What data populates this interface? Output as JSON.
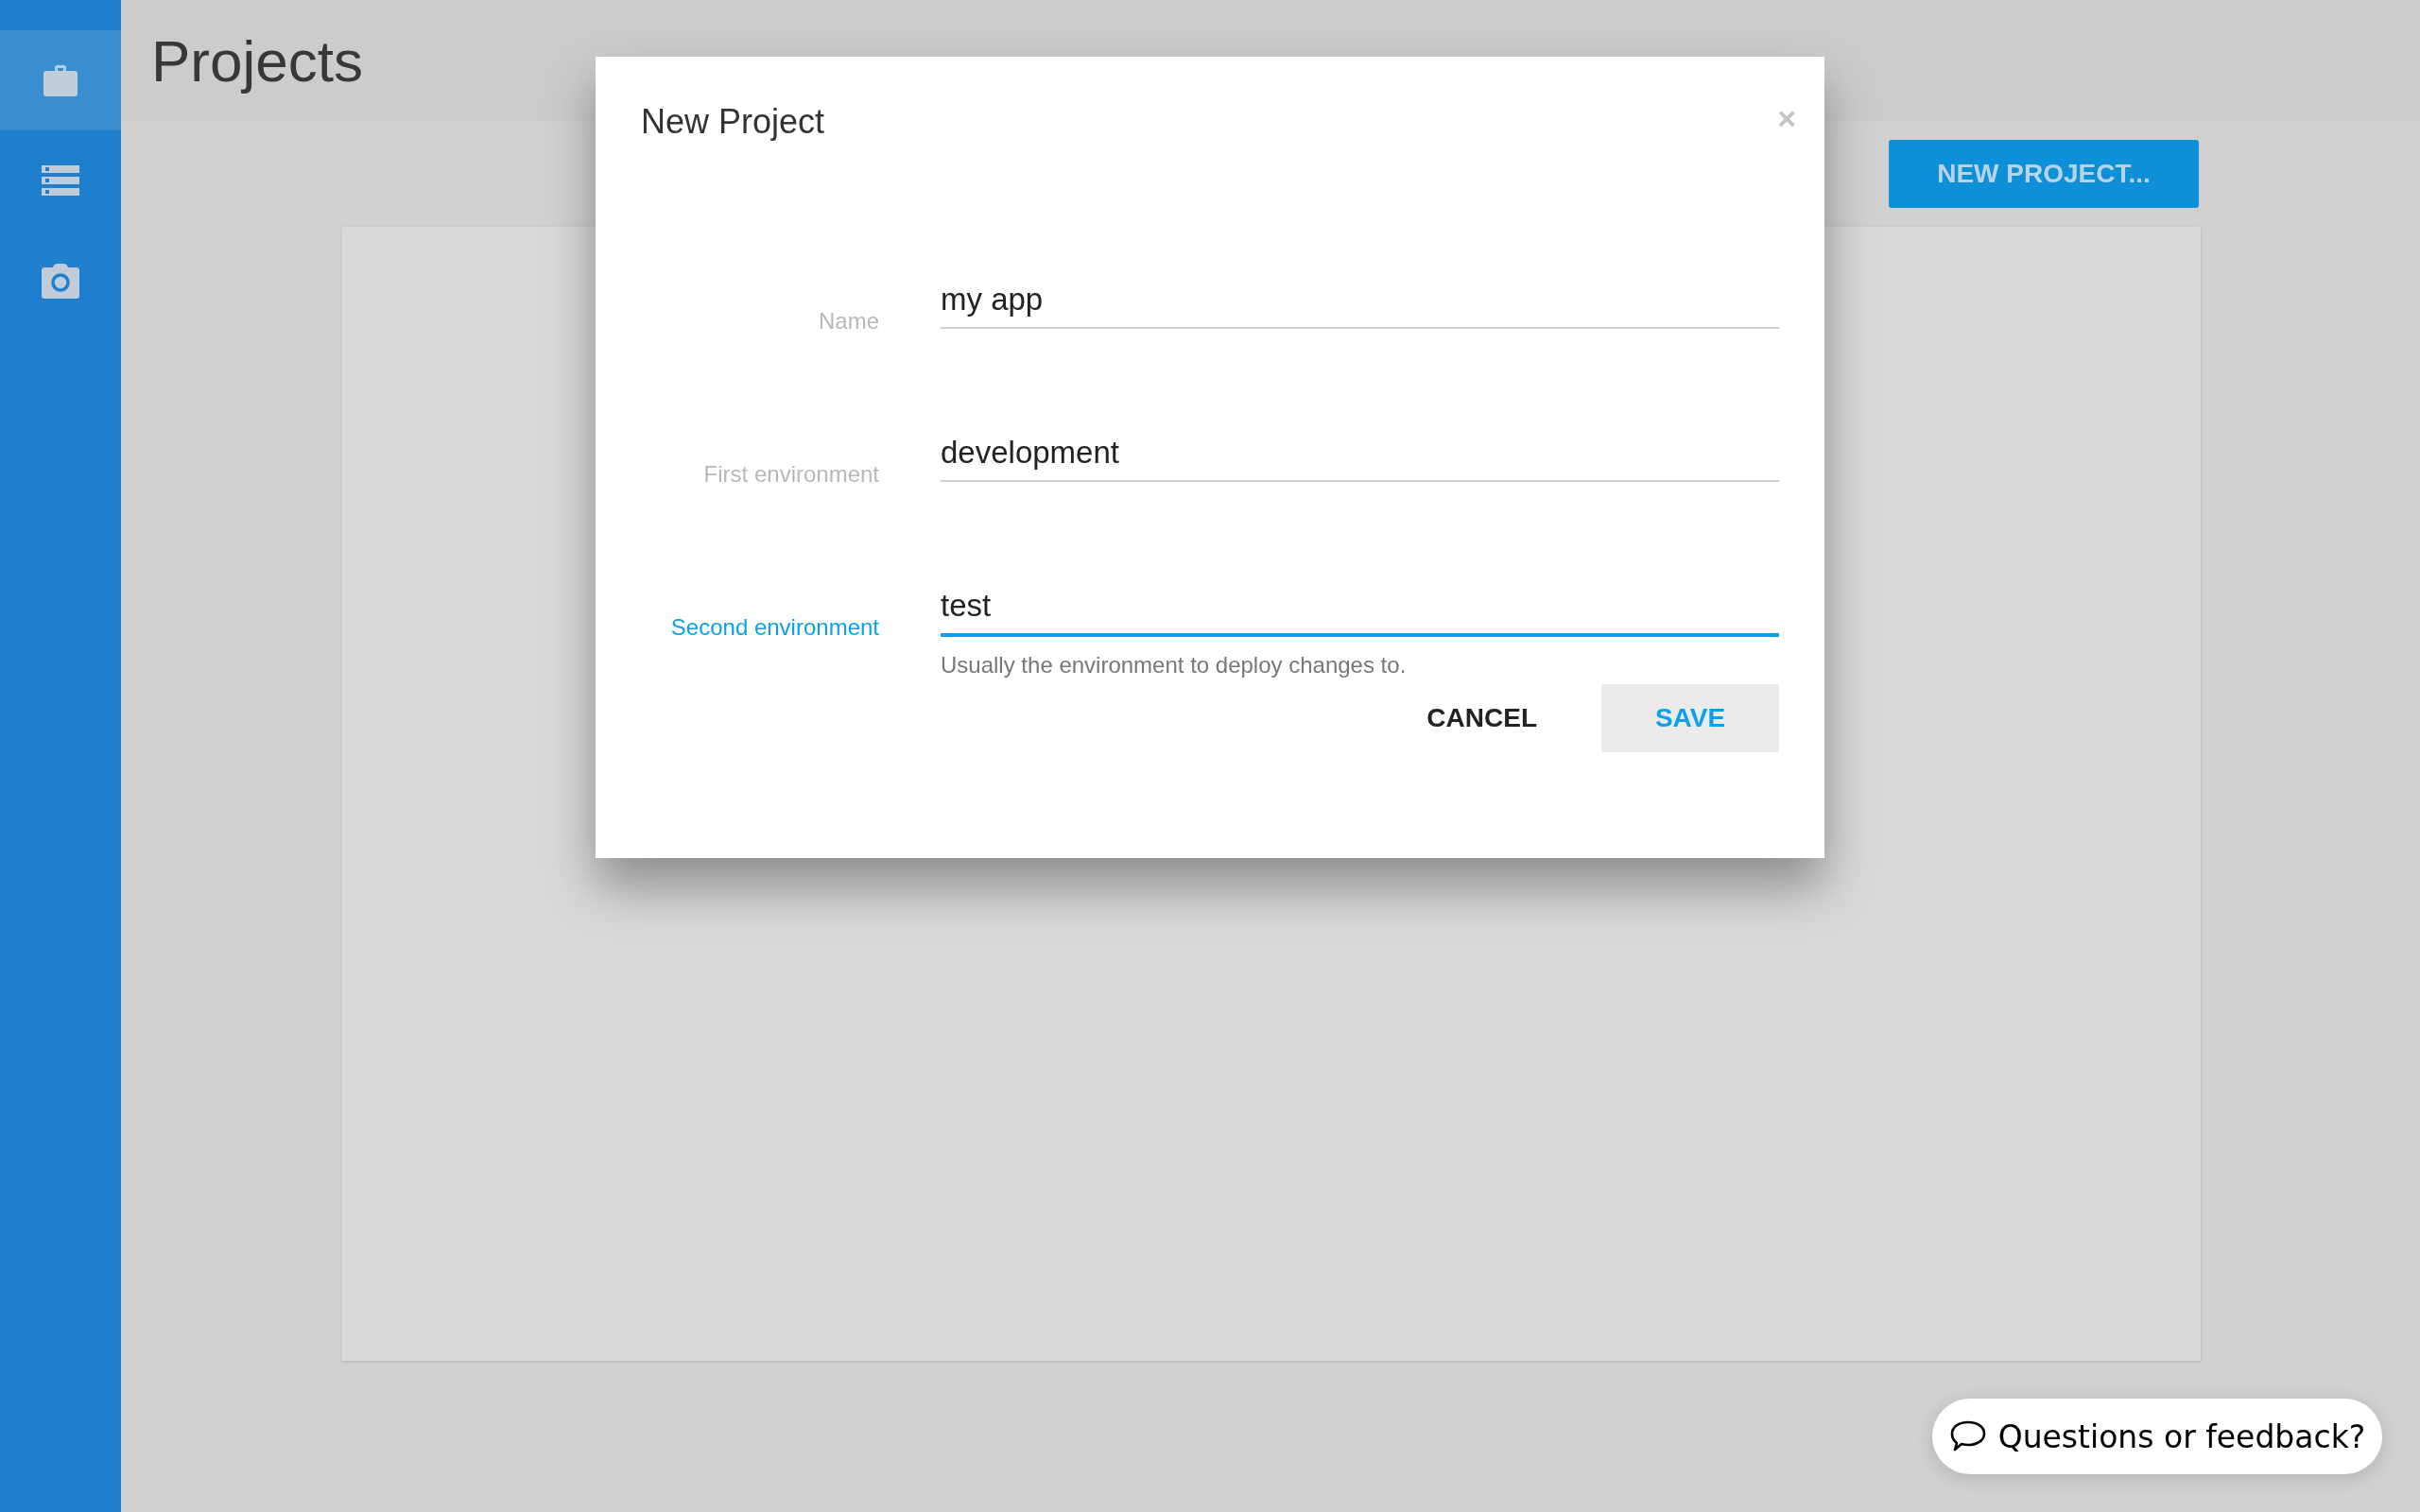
{
  "sidebar": {
    "items": [
      {
        "kind": "briefcase",
        "selected": true
      },
      {
        "kind": "servers",
        "selected": false
      },
      {
        "kind": "camera",
        "selected": false
      }
    ]
  },
  "header": {
    "title": "Projects"
  },
  "new_project_button": "NEW PROJECT...",
  "dialog": {
    "title": "New Project",
    "close": "×",
    "fields": [
      {
        "label": "Name",
        "value": "my app",
        "focused": false
      },
      {
        "label": "First environment",
        "value": "development",
        "focused": false
      },
      {
        "label": "Second environment",
        "value": "test",
        "focused": true,
        "help": "Usually the environment to deploy changes to."
      }
    ],
    "buttons": [
      {
        "label": "CANCEL",
        "kind": "flat"
      },
      {
        "label": "SAVE",
        "kind": "primary"
      }
    ]
  },
  "feedback_button": "Questions or feedback?"
}
